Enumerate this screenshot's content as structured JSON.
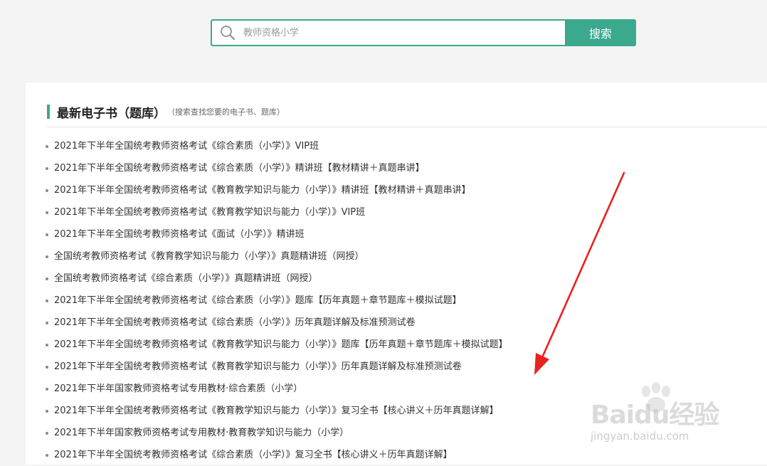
{
  "search": {
    "placeholder": "教师资格小学",
    "button_label": "搜索"
  },
  "section": {
    "title": "最新电子书（题库）",
    "subtitle": "（搜索查找您要的电子书、题库）"
  },
  "books": [
    "2021年下半年全国统考教师资格考试《综合素质（小学）》VIP班",
    "2021年下半年全国统考教师资格考试《综合素质（小学）》精讲班【教材精讲＋真题串讲】",
    "2021年下半年全国统考教师资格考试《教育教学知识与能力（小学）》精讲班【教材精讲＋真题串讲】",
    "2021年下半年全国统考教师资格考试《教育教学知识与能力（小学）》VIP班",
    "2021年下半年全国统考教师资格考试《面试（小学）》精讲班",
    "全国统考教师资格考试《教育教学知识与能力（小学）》真题精讲班（网授）",
    "全国统考教师资格考试《综合素质（小学）》真题精讲班（网授）",
    "2021年下半年全国统考教师资格考试《综合素质（小学）》题库【历年真题＋章节题库＋模拟试题】",
    "2021年下半年全国统考教师资格考试《综合素质（小学）》历年真题详解及标准预测试卷",
    "2021年下半年全国统考教师资格考试《教育教学知识与能力（小学）》题库【历年真题＋章节题库＋模拟试题】",
    "2021年下半年全国统考教师资格考试《教育教学知识与能力（小学）》历年真题详解及标准预测试卷",
    "2021年下半年国家教师资格考试专用教材·综合素质（小学）",
    "2021年下半年全国统考教师资格考试《教育教学知识与能力（小学）》复习全书【核心讲义＋历年真题详解】",
    "2021年下半年国家教师资格考试专用教材·教育教学知识与能力（小学）",
    "2021年下半年全国统考教师资格考试《综合素质（小学）》复习全书【核心讲义＋历年真题详解】"
  ],
  "watermark": {
    "brand": "Baidu经验",
    "url": "jingyan.baidu.com"
  },
  "colors": {
    "accent": "#3aa98e",
    "annotation": "#e8231e"
  },
  "icons": {
    "search": "search-icon",
    "arrow": "red-arrow-icon",
    "paw": "baidu-paw-icon"
  }
}
